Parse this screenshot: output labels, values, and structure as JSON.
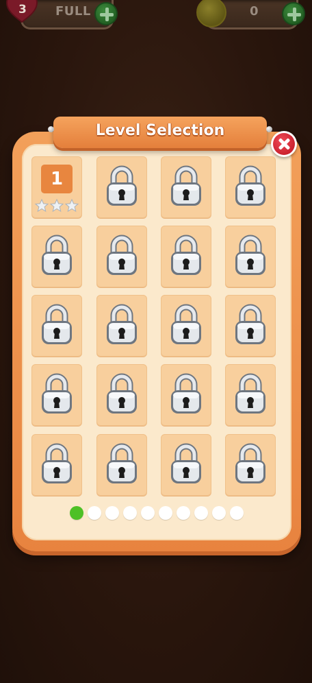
{
  "hud": {
    "lives_count": "3",
    "lives_status": "FULL",
    "coins": "0"
  },
  "panel": {
    "title": "Level Selection"
  },
  "levels": [
    {
      "number": "1",
      "locked": false,
      "stars": 0,
      "max_stars": 3
    },
    {
      "locked": true
    },
    {
      "locked": true
    },
    {
      "locked": true
    },
    {
      "locked": true
    },
    {
      "locked": true
    },
    {
      "locked": true
    },
    {
      "locked": true
    },
    {
      "locked": true
    },
    {
      "locked": true
    },
    {
      "locked": true
    },
    {
      "locked": true
    },
    {
      "locked": true
    },
    {
      "locked": true
    },
    {
      "locked": true
    },
    {
      "locked": true
    },
    {
      "locked": true
    },
    {
      "locked": true
    },
    {
      "locked": true
    },
    {
      "locked": true
    }
  ],
  "pager": {
    "total_pages": 10,
    "current_page": 1
  },
  "colors": {
    "panel_orange": "#e8833f",
    "tile": "#f8cf9d",
    "active_dot": "#4ec026",
    "close_red": "#c9202e"
  }
}
